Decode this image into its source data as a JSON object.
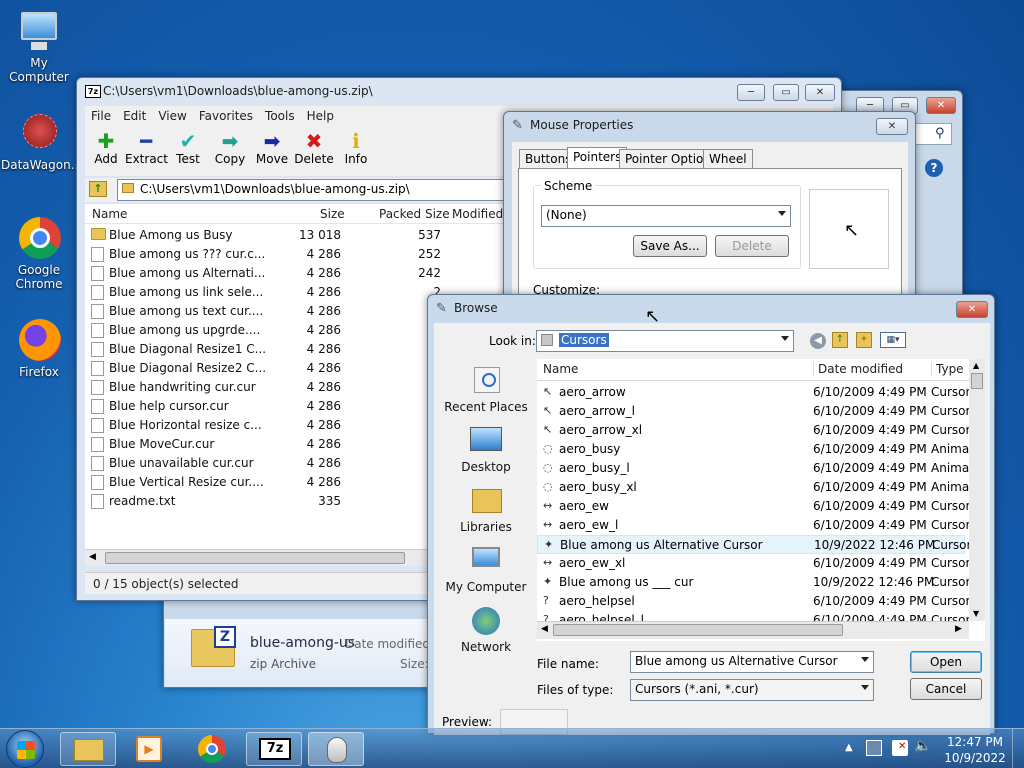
{
  "desktop": {
    "icons": [
      {
        "label": "My Computer"
      },
      {
        "label": "DataWagon..."
      },
      {
        "label": "Google Chrome"
      },
      {
        "label": "Firefox"
      }
    ]
  },
  "zip_window": {
    "title": "C:\\Users\\vm1\\Downloads\\blue-among-us.zip\\",
    "menu": [
      "File",
      "Edit",
      "View",
      "Favorites",
      "Tools",
      "Help"
    ],
    "toolbar": [
      "Add",
      "Extract",
      "Test",
      "Copy",
      "Move",
      "Delete",
      "Info"
    ],
    "address": "C:\\Users\\vm1\\Downloads\\blue-among-us.zip\\",
    "columns": [
      "Name",
      "Size",
      "Packed Size",
      "Modified"
    ],
    "rows": [
      {
        "name": "Blue Among us Busy",
        "size": "13 018",
        "packed": "537",
        "folder": true
      },
      {
        "name": "Blue among us ??? cur.c...",
        "size": "4 286",
        "packed": "252"
      },
      {
        "name": "Blue among us Alternati...",
        "size": "4 286",
        "packed": "242"
      },
      {
        "name": "Blue among us link sele...",
        "size": "4 286",
        "packed": "2"
      },
      {
        "name": "Blue among us text cur....",
        "size": "4 286",
        "packed": "2"
      },
      {
        "name": "Blue among us upgrde....",
        "size": "4 286",
        "packed": "2"
      },
      {
        "name": "Blue Diagonal Resize1 C...",
        "size": "4 286",
        "packed": "3"
      },
      {
        "name": "Blue Diagonal Resize2 C...",
        "size": "4 286",
        "packed": "3"
      },
      {
        "name": "Blue handwriting cur.cur",
        "size": "4 286",
        "packed": "3"
      },
      {
        "name": "Blue help cursor.cur",
        "size": "4 286",
        "packed": "3"
      },
      {
        "name": "Blue Horizontal resize c...",
        "size": "4 286",
        "packed": "2"
      },
      {
        "name": "Blue MoveCur.cur",
        "size": "4 286",
        "packed": "3"
      },
      {
        "name": "Blue unavailable cur.cur",
        "size": "4 286",
        "packed": "1"
      },
      {
        "name": "Blue Vertical Resize cur....",
        "size": "4 286",
        "packed": "2"
      },
      {
        "name": "readme.txt",
        "size": "335",
        "packed": "2"
      }
    ],
    "status": "0 / 15 object(s) selected"
  },
  "explorer_preview": {
    "filename": "blue-among-us",
    "filetype": "zip Archive",
    "date_label": "Date modified:",
    "size_label": "Size:"
  },
  "mouse_props": {
    "title": "Mouse Properties",
    "tabs": [
      "Buttons",
      "Pointers",
      "Pointer Options",
      "Wheel"
    ],
    "scheme_label": "Scheme",
    "scheme_value": "(None)",
    "save_as": "Save As...",
    "delete": "Delete",
    "customize": "Customize:"
  },
  "browse": {
    "title": "Browse",
    "look_in_label": "Look in:",
    "look_in_value": "Cursors",
    "places": [
      "Recent Places",
      "Desktop",
      "Libraries",
      "My Computer",
      "Network"
    ],
    "columns": [
      "Name",
      "Date modified",
      "Type"
    ],
    "rows": [
      {
        "name": "aero_arrow",
        "date": "6/10/2009 4:49 PM",
        "type": "Cursor",
        "icon": "↖"
      },
      {
        "name": "aero_arrow_l",
        "date": "6/10/2009 4:49 PM",
        "type": "Cursor",
        "icon": "↖"
      },
      {
        "name": "aero_arrow_xl",
        "date": "6/10/2009 4:49 PM",
        "type": "Cursor",
        "icon": "↖"
      },
      {
        "name": "aero_busy",
        "date": "6/10/2009 4:49 PM",
        "type": "Anima",
        "icon": "◌"
      },
      {
        "name": "aero_busy_l",
        "date": "6/10/2009 4:49 PM",
        "type": "Anima",
        "icon": "◌"
      },
      {
        "name": "aero_busy_xl",
        "date": "6/10/2009 4:49 PM",
        "type": "Anima",
        "icon": "◌"
      },
      {
        "name": "aero_ew",
        "date": "6/10/2009 4:49 PM",
        "type": "Cursor",
        "icon": "↔"
      },
      {
        "name": "aero_ew_l",
        "date": "6/10/2009 4:49 PM",
        "type": "Cursor",
        "icon": "↔"
      },
      {
        "name": "Blue among us Alternative Cursor",
        "date": "10/9/2022 12:46 PM",
        "type": "Cursor",
        "icon": "✦"
      },
      {
        "name": "aero_ew_xl",
        "date": "6/10/2009 4:49 PM",
        "type": "Cursor",
        "icon": "↔"
      },
      {
        "name": "Blue among us ___ cur",
        "date": "10/9/2022 12:46 PM",
        "type": "Cursor",
        "icon": "✦"
      },
      {
        "name": "aero_helpsel",
        "date": "6/10/2009 4:49 PM",
        "type": "Cursor",
        "icon": "?"
      },
      {
        "name": "aero_helpsel_l",
        "date": "6/10/2009 4:49 PM",
        "type": "Cursor",
        "icon": "?"
      }
    ],
    "filename_label": "File name:",
    "filename_value": "Blue among us Alternative Cursor",
    "filetype_label": "Files of type:",
    "filetype_value": "Cursors (*.ani, *.cur)",
    "open": "Open",
    "cancel": "Cancel",
    "preview": "Preview:"
  },
  "taskbar": {
    "time": "12:47 PM",
    "date": "10/9/2022",
    "items": [
      "explorer",
      "media-player",
      "chrome",
      "7-zip",
      "mouse"
    ]
  }
}
